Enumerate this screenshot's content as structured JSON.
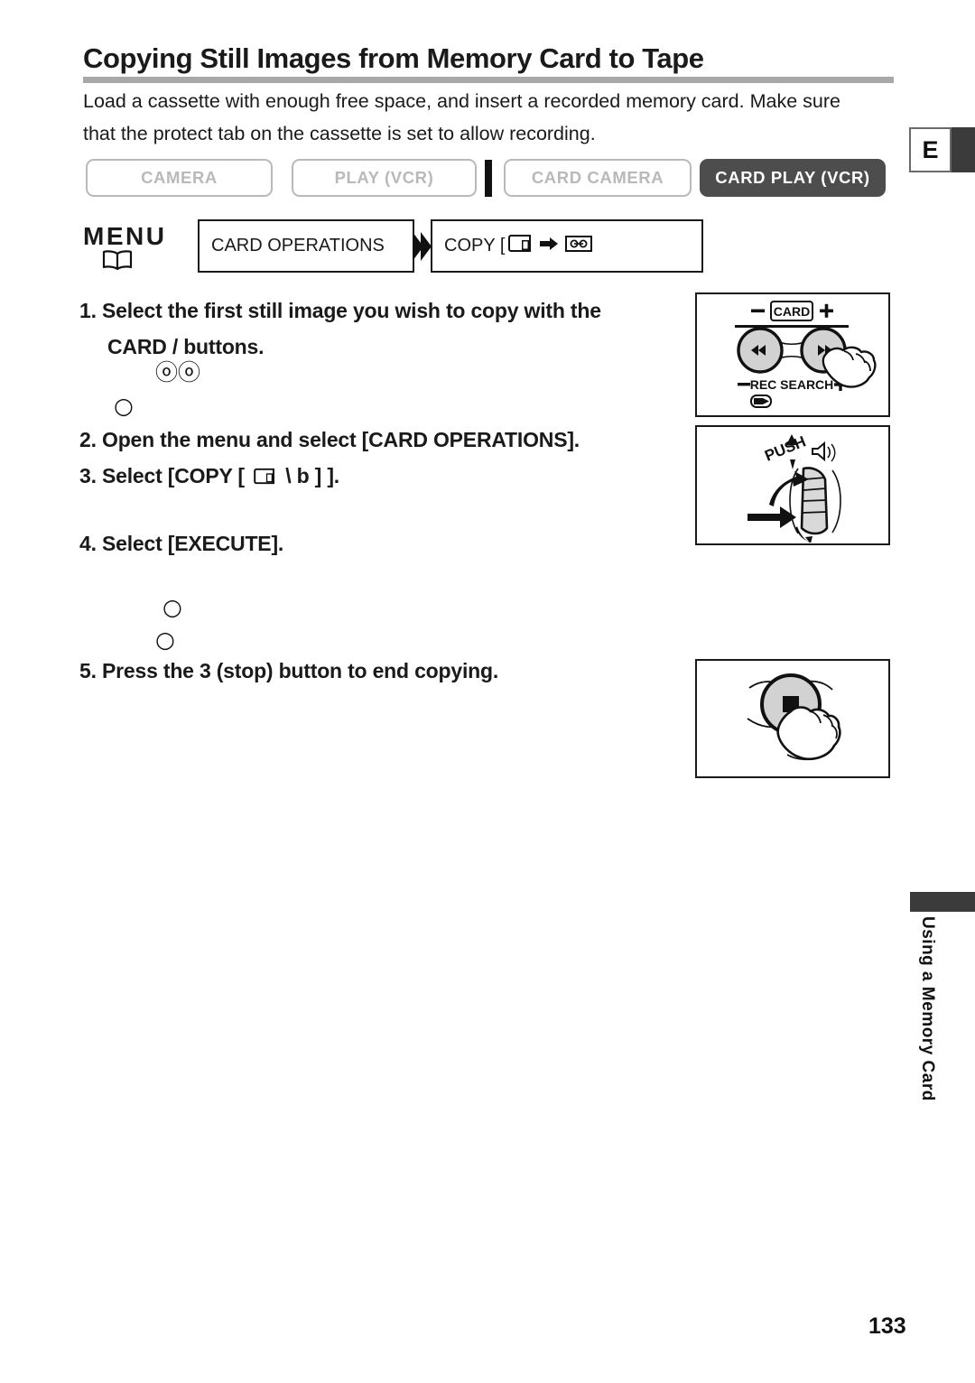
{
  "page": {
    "title": "Copying Still Images from Memory Card to Tape",
    "intro": "Load a cassette with enough free space, and insert a recorded memory card. Make sure that the protect tab on the cassette is set to allow recording.",
    "number": "133",
    "edition_marker": "E",
    "side_tab_label": "Using a Memory Card"
  },
  "modes": {
    "items": [
      {
        "label": "CAMERA",
        "state": "inactive"
      },
      {
        "label": "PLAY (VCR)",
        "state": "inactive"
      },
      {
        "label": "CARD CAMERA",
        "state": "inactive"
      },
      {
        "label": "CARD PLAY (VCR)",
        "state": "active"
      }
    ]
  },
  "menu_flow": {
    "menu_label": "MENU",
    "book_icon": "open-book-icon",
    "arrow_icon": "double-chevron-right-icon",
    "box1": "CARD OPERATIONS",
    "box2_prefix": "COPY [",
    "box2_source_icon": "memory-card-icon",
    "box2_arrow_icon": "right-arrow-icon",
    "box2_target_icon": "cassette-tape-icon"
  },
  "steps": [
    {
      "number": "1.",
      "text": "Select the first still image you wish to copy with the",
      "text_line2": "CARD   / buttons."
    },
    {
      "number": "2.",
      "text": "Open the menu and select [CARD OPERATIONS]."
    },
    {
      "number": "3.",
      "text_prefix": "Select [COPY [",
      "text_suffix": " \\   b  ] ].",
      "card_icon": "memory-card-icon"
    },
    {
      "number": "4.",
      "text": "Select [EXECUTE]."
    },
    {
      "number": "5.",
      "text": "Press the 3  (stop) button to end copying."
    }
  ],
  "missing_glyphs": {
    "g1": "ⓞⓞ",
    "g2": "○",
    "g3": "○",
    "g4": "○"
  },
  "illustrations": [
    {
      "name": "card-rec-search-buttons-illustration",
      "labels": {
        "minus": "–",
        "card": "CARD",
        "plus": "+",
        "rec_search": "REC SEARCH"
      }
    },
    {
      "name": "push-selector-dial-illustration",
      "labels": {
        "push": "PUSH"
      }
    },
    {
      "name": "stop-button-illustration",
      "labels": {}
    }
  ],
  "colors": {
    "active_mode_bg": "#4d4d4d",
    "inactive_mode": "#b9b9b9",
    "title_rule": "#a8a8a8",
    "tab_dark": "#3b3b3b",
    "text": "#1a1a1a"
  }
}
